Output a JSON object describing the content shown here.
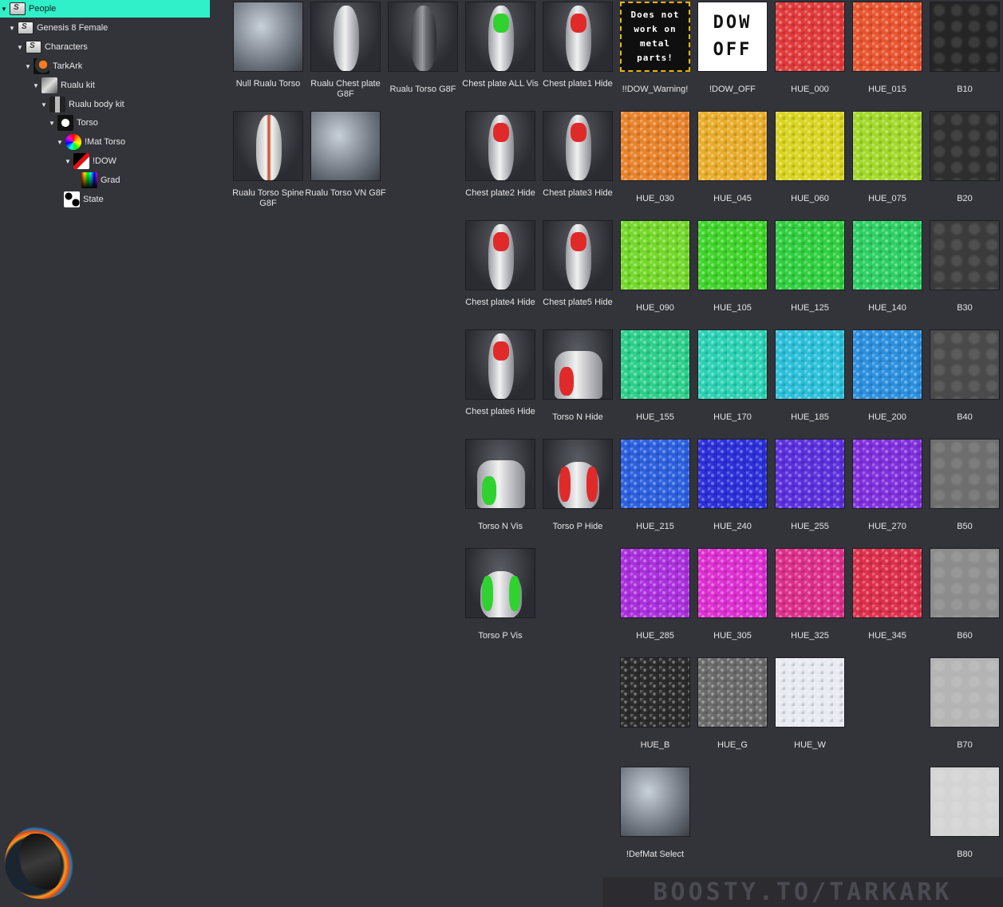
{
  "tree": {
    "items": [
      {
        "label": "People",
        "icon": "folder-icon",
        "level": 0,
        "arrow": "▼",
        "selected": true
      },
      {
        "label": "Genesis 8 Female",
        "icon": "folder-icon",
        "level": 1,
        "arrow": "▼"
      },
      {
        "label": "Characters",
        "icon": "folder-icon",
        "level": 2,
        "arrow": "▼"
      },
      {
        "label": "TarkArk",
        "icon": "dragon-icon",
        "level": 3,
        "arrow": "▼"
      },
      {
        "label": "Rualu kit",
        "icon": "kit-icon",
        "level": 4,
        "arrow": "▼"
      },
      {
        "label": "Rualu body kit",
        "icon": "body-icon",
        "level": 5,
        "arrow": "▼"
      },
      {
        "label": "Torso",
        "icon": "torso-icon",
        "level": 6,
        "arrow": "▼"
      },
      {
        "label": "!Mat Torso",
        "icon": "material-icon",
        "level": 7,
        "arrow": "▼"
      },
      {
        "label": "!DOW",
        "icon": "dow-icon",
        "level": 8,
        "arrow": "▼"
      },
      {
        "label": "Grad",
        "icon": "gradient-icon",
        "level": 9,
        "arrow": ""
      },
      {
        "label": "State",
        "icon": "state-icon",
        "level": 7,
        "arrow": ""
      }
    ]
  },
  "grid": {
    "items": [
      {
        "label": "Null Rualu Torso",
        "thumb": "metal"
      },
      {
        "label": "Rualu Chest plate G8F",
        "thumb": "body"
      },
      {
        "label": "Rualu Torso G8F",
        "thumb": "body-dark"
      },
      {
        "label": "Chest plate ALL Vis",
        "thumb": "body",
        "accent": "#2fd22f"
      },
      {
        "label": "Chest plate1 Hide",
        "thumb": "body",
        "accent": "#e02a2a"
      },
      {
        "label": "!!DOW_Warning!",
        "thumb": "warning",
        "text": "Does not work on metal parts!"
      },
      {
        "label": "!DOW_OFF",
        "thumb": "off",
        "text": "DOW OFF"
      },
      {
        "label": "HUE_000",
        "thumb": "hue",
        "color": "#e03a3a"
      },
      {
        "label": "HUE_015",
        "thumb": "hue",
        "color": "#e9542f"
      },
      {
        "label": "B10",
        "thumb": "bump",
        "color": "#252525"
      },
      {
        "label": "Rualu Torso Spine G8F",
        "thumb": "spine"
      },
      {
        "label": "Rualu Torso VN G8F",
        "thumb": "metal"
      },
      {
        "label": "Chest plate2 Hide",
        "thumb": "body",
        "accent": "#e02a2a"
      },
      {
        "label": "Chest plate3 Hide",
        "thumb": "body",
        "accent": "#e02a2a"
      },
      {
        "label": "HUE_030",
        "thumb": "hue",
        "color": "#e7832b"
      },
      {
        "label": "HUE_045",
        "thumb": "hue",
        "color": "#e8ad2b"
      },
      {
        "label": "HUE_060",
        "thumb": "hue",
        "color": "#d9d421"
      },
      {
        "label": "HUE_075",
        "thumb": "hue",
        "color": "#a2d82a"
      },
      {
        "label": "B20",
        "thumb": "bump",
        "color": "#2e2e2e"
      },
      {
        "label": "Chest plate4 Hide",
        "thumb": "body",
        "accent": "#e02a2a"
      },
      {
        "label": "Chest plate5 Hide",
        "thumb": "body",
        "accent": "#e02a2a"
      },
      {
        "label": "HUE_090",
        "thumb": "hue",
        "color": "#73d82a"
      },
      {
        "label": "HUE_105",
        "thumb": "hue",
        "color": "#3fd42a"
      },
      {
        "label": "HUE_125",
        "thumb": "hue",
        "color": "#2fcf3f"
      },
      {
        "label": "HUE_140",
        "thumb": "hue",
        "color": "#2ccf63"
      },
      {
        "label": "B30",
        "thumb": "bump",
        "color": "#3b3b3b"
      },
      {
        "label": "Chest plate6 Hide",
        "thumb": "body",
        "accent": "#e02a2a"
      },
      {
        "label": "Torso N Hide",
        "thumb": "neck",
        "accent": "#e02a2a"
      },
      {
        "label": "HUE_155",
        "thumb": "hue",
        "color": "#2ccf8a"
      },
      {
        "label": "HUE_170",
        "thumb": "hue",
        "color": "#2bd1b4"
      },
      {
        "label": "HUE_185",
        "thumb": "hue",
        "color": "#2bbfd9"
      },
      {
        "label": "HUE_200",
        "thumb": "hue",
        "color": "#2b8fdd"
      },
      {
        "label": "B40",
        "thumb": "bump",
        "color": "#4a4a4a"
      },
      {
        "label": "Torso N Vis",
        "thumb": "neck",
        "accent": "#2fd22f"
      },
      {
        "label": "Torso P Hide",
        "thumb": "back",
        "accent": "#e02a2a"
      },
      {
        "label": "HUE_215",
        "thumb": "hue",
        "color": "#2b5fdd"
      },
      {
        "label": "HUE_240",
        "thumb": "hue",
        "color": "#2b2fd8"
      },
      {
        "label": "HUE_255",
        "thumb": "hue",
        "color": "#5a2fdc"
      },
      {
        "label": "HUE_270",
        "thumb": "hue",
        "color": "#7f2fdc"
      },
      {
        "label": "B50",
        "thumb": "bump",
        "color": "#6e6e6e"
      },
      {
        "label": "Torso P Vis",
        "thumb": "back",
        "accent": "#2fd22f"
      },
      {
        "label": "HUE_285",
        "thumb": "hue",
        "color": "#aa2fdc"
      },
      {
        "label": "HUE_305",
        "thumb": "hue",
        "color": "#dc2fd0"
      },
      {
        "label": "HUE_325",
        "thumb": "hue",
        "color": "#dc2f8a"
      },
      {
        "label": "HUE_345",
        "thumb": "hue",
        "color": "#dc2f4a"
      },
      {
        "label": "B60",
        "thumb": "bump",
        "color": "#8c8c8c"
      },
      {
        "label": "HUE_B",
        "thumb": "hue",
        "color": "#2a2a2a"
      },
      {
        "label": "HUE_G",
        "thumb": "hue",
        "color": "#6a6a6a"
      },
      {
        "label": "HUE_W",
        "thumb": "hue",
        "color": "#e8eaf2"
      },
      {
        "label": "B70",
        "thumb": "bump",
        "color": "#b4b4b4"
      },
      {
        "label": "!DefMat Select",
        "thumb": "metal"
      },
      {
        "label": "B80",
        "thumb": "bump",
        "color": "#d4d4d4"
      }
    ]
  },
  "watermark": "BOOSTY.TO/TARKARK"
}
